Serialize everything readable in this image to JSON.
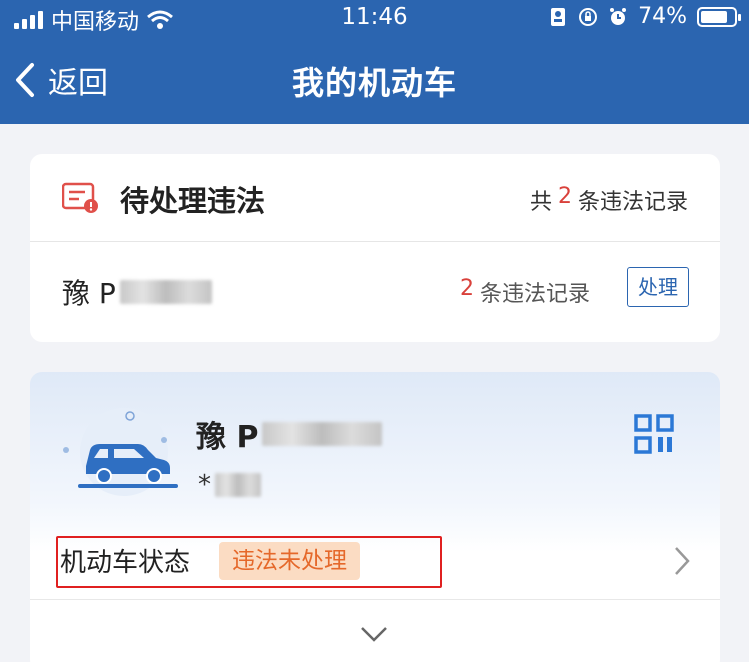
{
  "status_bar": {
    "carrier": "中国移动",
    "time": "11:46",
    "battery": "74%"
  },
  "nav": {
    "back_label": "返回",
    "title": "我的机动车"
  },
  "pending": {
    "title": "待处理违法",
    "summary_prefix": "共",
    "summary_count": "2",
    "summary_suffix": "条违法记录",
    "plate_prefix": "豫 P",
    "plate_count": "2",
    "plate_count_suffix": "条违法记录",
    "handle_label": "处理"
  },
  "vehicle": {
    "plate_prefix": "豫 P",
    "sub_prefix": "*",
    "status_label": "机动车状态",
    "status_badge": "违法未处理"
  },
  "colors": {
    "header": "#2b65b0",
    "accent_red": "#d9413b",
    "badge_bg": "#fbdcc3",
    "badge_text": "#e5682a"
  },
  "icons": [
    "wifi-icon",
    "back-chevron-icon",
    "violation-ticket-icon",
    "car-icon",
    "qr-code-icon",
    "chevron-right-icon",
    "chevron-down-icon"
  ]
}
